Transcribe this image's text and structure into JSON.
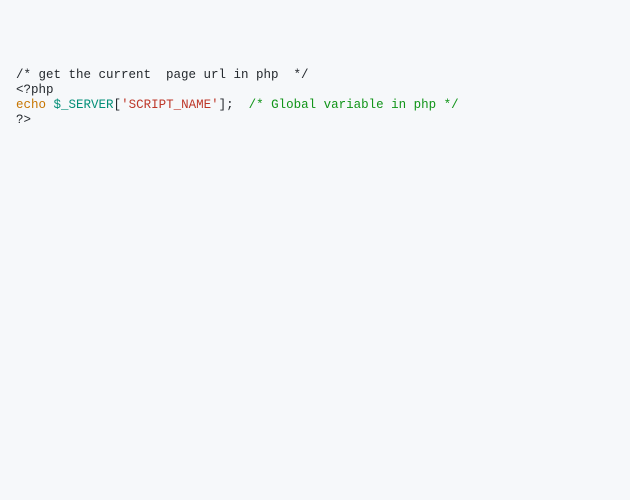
{
  "code": {
    "line1": {
      "comment": "/* get the current  page url in php  */"
    },
    "line2": {
      "open_tag": "<?php"
    },
    "line3": {
      "echo": "echo",
      "space1": " ",
      "server_var": "$_SERVER",
      "open_bracket": "[",
      "string": "'SCRIPT_NAME'",
      "close_bracket_semi": "];",
      "space2": "  ",
      "inline_comment": "/* Global variable in php */"
    },
    "line4": {
      "close_tag": "?>"
    }
  }
}
